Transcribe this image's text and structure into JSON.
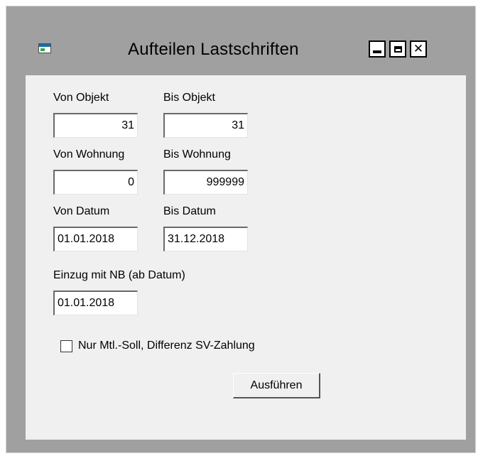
{
  "window": {
    "title": "Aufteilen Lastschriften",
    "icon": "app-window-icon",
    "controls": {
      "minimize_icon": "minimize-icon",
      "maximize_icon": "maximize-icon",
      "close_icon": "close-icon",
      "close_glyph": "✕"
    }
  },
  "form": {
    "von_objekt": {
      "label": "Von Objekt",
      "value": "31"
    },
    "bis_objekt": {
      "label": "Bis Objekt",
      "value": "31"
    },
    "von_wohnung": {
      "label": "Von Wohnung",
      "value": "0"
    },
    "bis_wohnung": {
      "label": "Bis Wohnung",
      "value": "999999"
    },
    "von_datum": {
      "label": "Von Datum",
      "value": "01.01.2018"
    },
    "bis_datum": {
      "label": "Bis Datum",
      "value": "31.12.2018"
    },
    "einzug": {
      "label": "Einzug mit NB (ab Datum)",
      "value": "01.01.2018"
    },
    "checkbox": {
      "label": "Nur Mtl.-Soll, Differenz SV-Zahlung",
      "checked": false
    },
    "run_button": {
      "label": "Ausführen"
    }
  },
  "colors": {
    "frame": "#a0a0a0",
    "client": "#f0f0f0",
    "field": "#ffffff",
    "icon_blue": "#1c6ea4",
    "icon_green": "#2fa84a"
  }
}
